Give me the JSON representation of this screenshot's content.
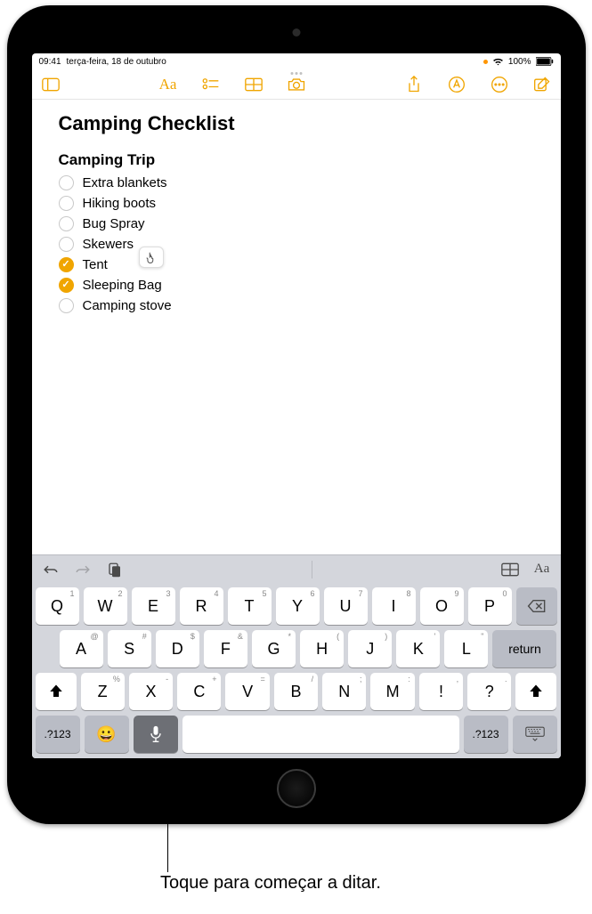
{
  "status": {
    "time": "09:41",
    "date": "terça-feira, 18 de outubro",
    "battery_pct": "100%",
    "wifi_icon": "wifi",
    "orange_dot": true
  },
  "toolbar": {
    "sidebar_icon": "sidebar",
    "format_icon": "Aa",
    "checklist_icon": "checklist",
    "table_icon": "table",
    "camera_icon": "camera",
    "share_icon": "share",
    "markup_icon": "markup",
    "more_icon": "more",
    "compose_icon": "compose"
  },
  "note": {
    "title": "Camping Checklist",
    "subtitle": "Camping Trip",
    "items": [
      {
        "label": "Extra blankets",
        "checked": false
      },
      {
        "label": "Hiking boots",
        "checked": false
      },
      {
        "label": "Bug Spray",
        "checked": false
      },
      {
        "label": "Skewers",
        "checked": false
      },
      {
        "label": "Tent",
        "checked": true
      },
      {
        "label": "Sleeping Bag",
        "checked": true
      },
      {
        "label": "Camping stove",
        "checked": false
      }
    ]
  },
  "keyboard_toolbar": {
    "undo": "undo",
    "redo": "redo",
    "paste": "paste",
    "table": "table",
    "format": "Aa"
  },
  "keyboard": {
    "row1": [
      {
        "main": "Q",
        "sub": "1"
      },
      {
        "main": "W",
        "sub": "2"
      },
      {
        "main": "E",
        "sub": "3"
      },
      {
        "main": "R",
        "sub": "4"
      },
      {
        "main": "T",
        "sub": "5"
      },
      {
        "main": "Y",
        "sub": "6"
      },
      {
        "main": "U",
        "sub": "7"
      },
      {
        "main": "I",
        "sub": "8"
      },
      {
        "main": "O",
        "sub": "9"
      },
      {
        "main": "P",
        "sub": "0"
      }
    ],
    "row2": [
      {
        "main": "A",
        "sub": "@"
      },
      {
        "main": "S",
        "sub": "#"
      },
      {
        "main": "D",
        "sub": "$"
      },
      {
        "main": "F",
        "sub": "&"
      },
      {
        "main": "G",
        "sub": "*"
      },
      {
        "main": "H",
        "sub": "("
      },
      {
        "main": "J",
        "sub": ")"
      },
      {
        "main": "K",
        "sub": "'"
      },
      {
        "main": "L",
        "sub": "\""
      }
    ],
    "row3": [
      {
        "main": "Z",
        "sub": "%"
      },
      {
        "main": "X",
        "sub": "-"
      },
      {
        "main": "C",
        "sub": "+"
      },
      {
        "main": "V",
        "sub": "="
      },
      {
        "main": "B",
        "sub": "/"
      },
      {
        "main": "N",
        "sub": ";"
      },
      {
        "main": "M",
        "sub": ":"
      },
      {
        "main": "!",
        "sub": ","
      },
      {
        "main": "?",
        "sub": "."
      }
    ],
    "return_label": "return",
    "sym_label": ".?123",
    "backspace": "⌫",
    "shift": "⇧",
    "emoji": "😀",
    "mic": "mic",
    "dismiss": "⌨"
  },
  "caption": "Toque para começar a ditar."
}
